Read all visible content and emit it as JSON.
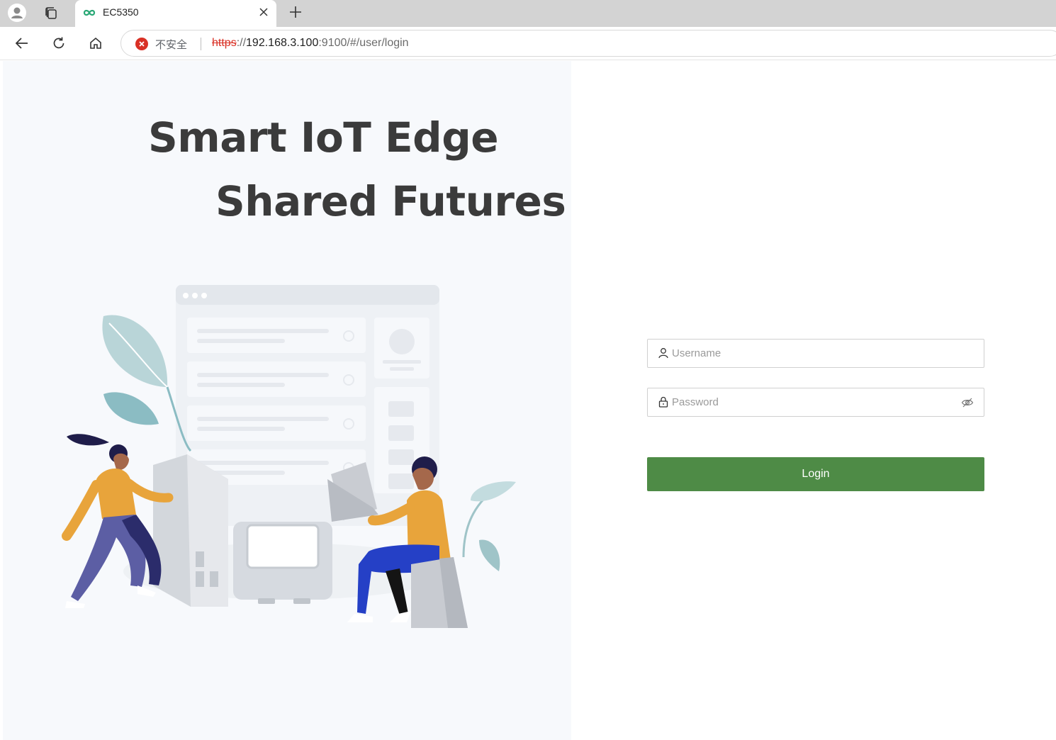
{
  "browser": {
    "tab": {
      "title": "EC5350"
    },
    "address_bar": {
      "security_label": "不安全",
      "url_scheme": "https",
      "url_sep": "://",
      "url_host": "192.168.3.100",
      "url_port": ":9100",
      "url_path": "/#/user/login"
    }
  },
  "hero": {
    "line1": "Smart IoT Edge",
    "line2": "Shared Futures"
  },
  "login_form": {
    "username": {
      "placeholder": "Username",
      "value": ""
    },
    "password": {
      "placeholder": "Password",
      "value": ""
    },
    "submit_label": "Login"
  },
  "colors": {
    "accent": "#4e8b46",
    "insecure_red": "#d93025",
    "headline": "#3b3b3b",
    "panel_bg": "#f7f9fc"
  },
  "icons": [
    "profile-icon",
    "collections-icon",
    "site-favicon",
    "close-tab-icon",
    "new-tab-icon",
    "back-icon",
    "reload-icon",
    "home-icon",
    "not-secure-icon",
    "user-icon",
    "lock-icon",
    "eye-off-icon"
  ]
}
